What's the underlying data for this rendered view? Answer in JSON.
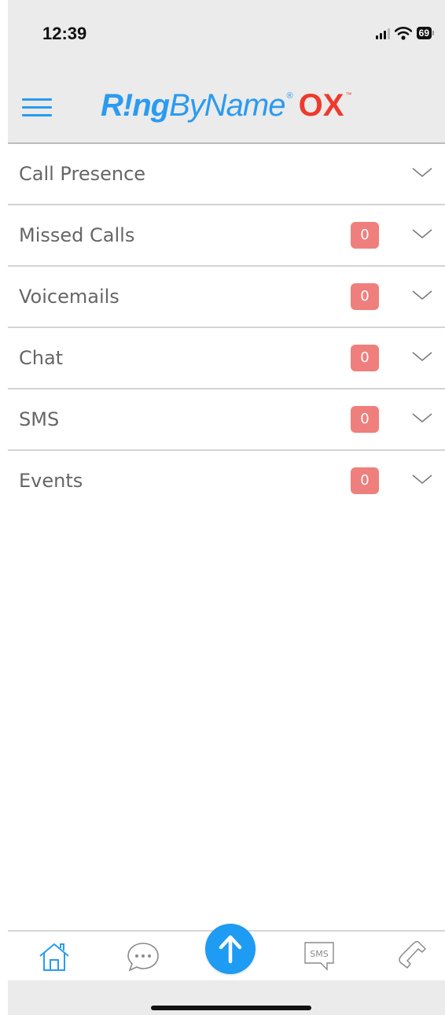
{
  "status_bar": {
    "time": "12:39",
    "battery": "69"
  },
  "header": {
    "logo_ring": "R!ng",
    "logo_byname": "ByName",
    "logo_registered": "®",
    "logo_ox": "OX",
    "logo_tm": "™"
  },
  "sections": [
    {
      "label": "Call Presence",
      "count": null
    },
    {
      "label": "Missed Calls",
      "count": "0"
    },
    {
      "label": "Voicemails",
      "count": "0"
    },
    {
      "label": "Chat",
      "count": "0"
    },
    {
      "label": "SMS",
      "count": "0"
    },
    {
      "label": "Events",
      "count": "0"
    }
  ],
  "tabbar": {
    "sms_icon_text": "SMS",
    "items": [
      "home-icon",
      "chat-bubble-icon",
      "upload-arrow-icon",
      "sms-icon",
      "phone-icon"
    ]
  },
  "colors": {
    "accent": "#2a9bf0",
    "brand_red": "#ee3a2c",
    "badge": "#ef7f7d",
    "header_bg": "#ebebeb"
  }
}
